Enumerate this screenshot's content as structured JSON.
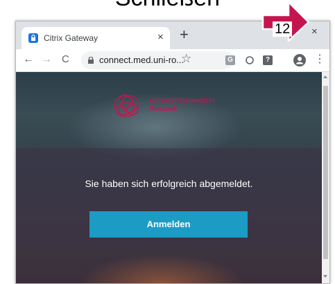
{
  "heading": "Schließen",
  "browser": {
    "tab": {
      "title": "Citrix Gateway",
      "close_icon": "close-icon",
      "favicon": "gateway-lock-icon"
    },
    "new_tab_label": "+",
    "window_close_glyph": "×",
    "tab_close_glyph": "×",
    "toolbar": {
      "back_glyph": "←",
      "forward_glyph": "→",
      "reload_glyph": "C",
      "url": "connect.med.uni-ro...",
      "bookmark_glyph": "☆",
      "ext_g_label": "G",
      "ext_help_label": "?",
      "menu_glyph": "⋮"
    }
  },
  "page": {
    "logo_line1": "universitätsmedizin",
    "logo_line2": "Rostock",
    "message": "Sie haben sich erfolgreich abgemeldet.",
    "button_label": "Anmelden"
  },
  "annotation": {
    "step_number": "12"
  },
  "colors": {
    "accent": "#1c9cc4",
    "logo": "#c5154f",
    "callout_fill": "#c5154f"
  }
}
